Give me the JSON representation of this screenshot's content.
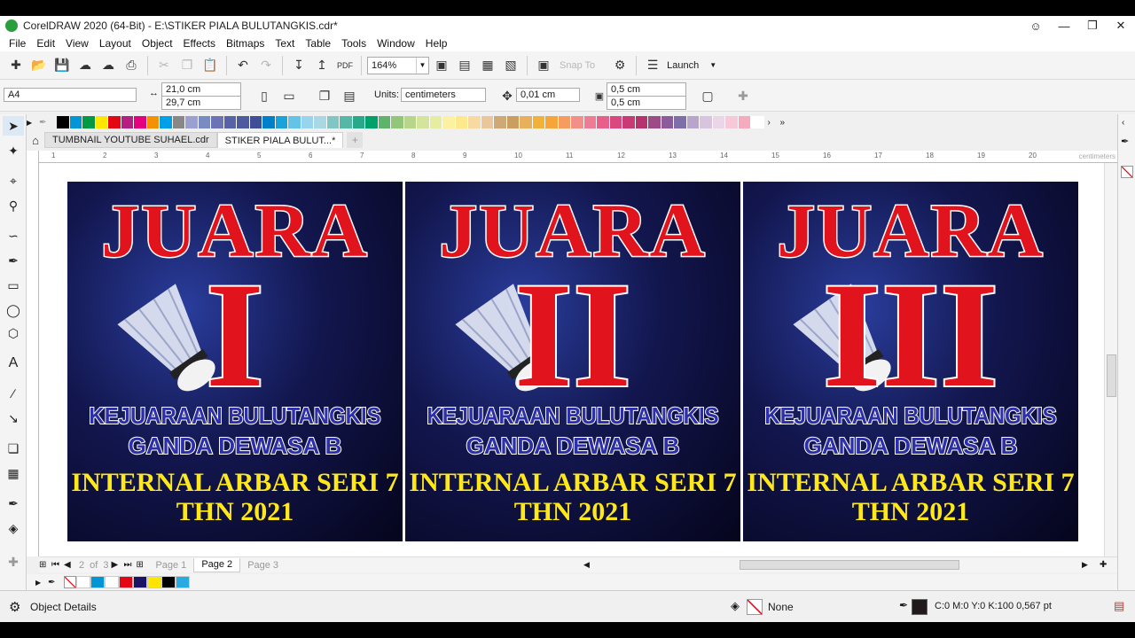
{
  "window": {
    "title": "CorelDRAW 2020 (64-Bit) - E:\\STIKER PIALA BULUTANGKIS.cdr*"
  },
  "menu": [
    "File",
    "Edit",
    "View",
    "Layout",
    "Object",
    "Effects",
    "Bitmaps",
    "Text",
    "Table",
    "Tools",
    "Window",
    "Help"
  ],
  "toolbar": {
    "zoom": "164%",
    "snap_label": "Snap To",
    "launch_label": "Launch"
  },
  "property_bar": {
    "page_size": "A4",
    "width": "21,0 cm",
    "height": "29,7 cm",
    "units_label": "Units:",
    "units_value": "centimeters",
    "nudge": "0,01 cm",
    "dup_x": "0,5 cm",
    "dup_y": "0,5 cm"
  },
  "palette_colors": [
    "#000000",
    "#0096d6",
    "#009a44",
    "#ffe600",
    "#e30613",
    "#b51f82",
    "#e4007f",
    "#f39200",
    "#00a0e9",
    "#888888",
    "#9aa0cf",
    "#7a8ac2",
    "#6c74b5",
    "#5663a9",
    "#4e5b9f",
    "#3f4e96",
    "#0080c9",
    "#1aa3d8",
    "#66c3e8",
    "#99d4ee",
    "#a9d8e4",
    "#7fc6c5",
    "#55b7a6",
    "#2aa988",
    "#00a06b",
    "#5fb36b",
    "#91c67b",
    "#b6d68b",
    "#d4e49b",
    "#e6ed9e",
    "#fcf1a0",
    "#fde98c",
    "#f7d9a1",
    "#e9c79a",
    "#cfa877",
    "#c99e60",
    "#e6b05c",
    "#f2b23a",
    "#f7a538",
    "#f59c5e",
    "#f28f86",
    "#ee7c95",
    "#e85f8c",
    "#d9487f",
    "#c73a75",
    "#b5346d",
    "#9c4b86",
    "#8c5c9a",
    "#7f6fa8",
    "#b9a4cc",
    "#d9c4de",
    "#ead6e6",
    "#f7c9d8",
    "#f5aabe",
    "#ffffff"
  ],
  "tabs": [
    {
      "label": "TUMBNAIL YOUTUBE SUHAEL.cdr"
    },
    {
      "label": "STIKER PIALA BULUT...*"
    }
  ],
  "ruler": {
    "ticks": [
      "1",
      "2",
      "3",
      "4",
      "5",
      "6",
      "7",
      "8",
      "9",
      "10",
      "11",
      "12",
      "13",
      "14",
      "15",
      "16",
      "17",
      "18",
      "19",
      "20"
    ],
    "unit": "centimeters"
  },
  "cards": [
    {
      "title": "JUARA",
      "rank": "I",
      "line1": "KEJUARAAN BULUTANGKIS",
      "line2": "GANDA DEWASA B",
      "line3": "INTERNAL ARBAR SERI 7",
      "line4": "THN 2021"
    },
    {
      "title": "JUARA",
      "rank": "II",
      "line1": "KEJUARAAN BULUTANGKIS",
      "line2": "GANDA DEWASA B",
      "line3": "INTERNAL ARBAR SERI 7",
      "line4": "THN 2021"
    },
    {
      "title": "JUARA",
      "rank": "III",
      "line1": "KEJUARAAN BULUTANGKIS",
      "line2": "GANDA DEWASA B",
      "line3": "INTERNAL ARBAR SERI 7",
      "line4": "THN 2021"
    }
  ],
  "pages": {
    "current": "2",
    "of_label": "of",
    "total": "3",
    "labels": [
      "Page 1",
      "Page 2",
      "Page 3"
    ]
  },
  "doc_palette": [
    "#ffffff",
    "#0096d6",
    "#ffffff",
    "#e30613",
    "#1b1464",
    "#ffe600",
    "#000000",
    "#29abe2"
  ],
  "status": {
    "object_details": "Object Details",
    "fill": "None",
    "outline": "C:0 M:0 Y:0 K:100  0,567 pt"
  }
}
